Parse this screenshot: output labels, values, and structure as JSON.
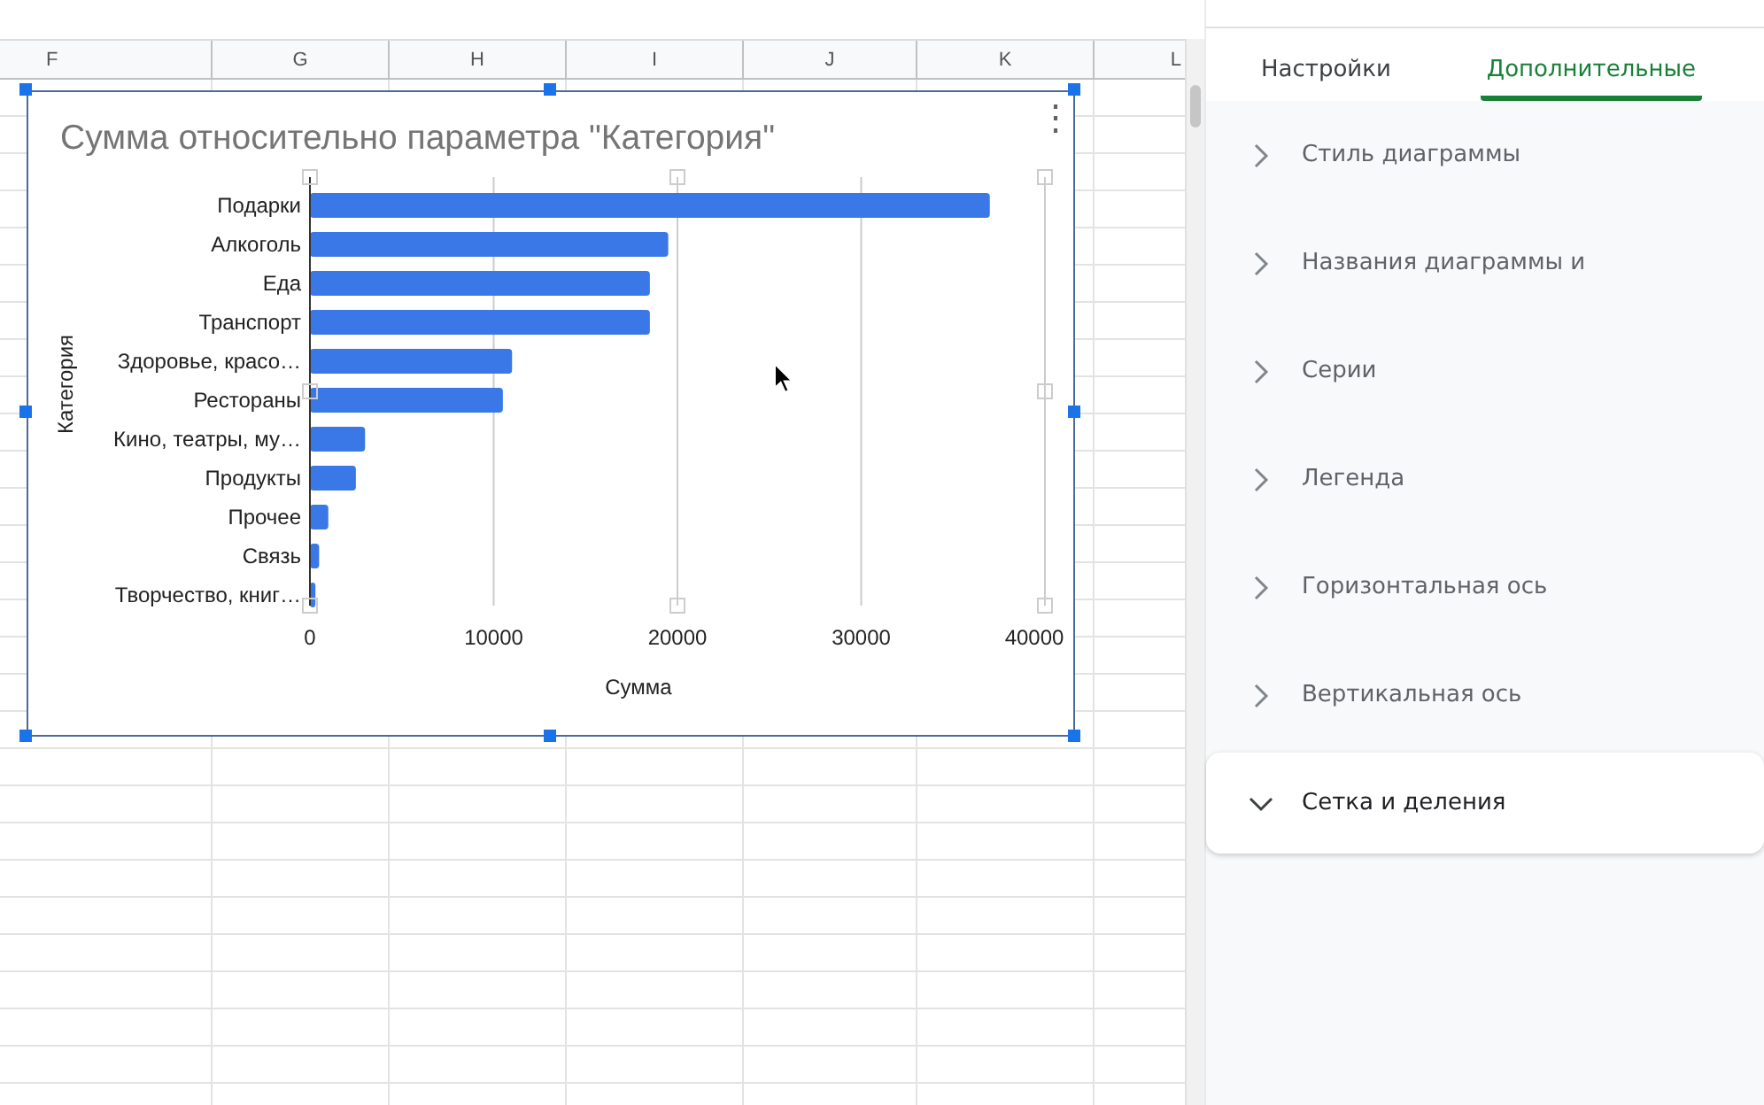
{
  "sheet": {
    "columns": [
      "F",
      "G",
      "H",
      "I",
      "J",
      "K",
      "L"
    ]
  },
  "chart": {
    "menu": "⋮",
    "chart_data": {
      "type": "bar",
      "orientation": "horizontal",
      "title": "Сумма относительно параметра \"Категория\"",
      "xlabel": "Сумма",
      "ylabel": "Категория",
      "categories": [
        "Подарки",
        "Алкоголь",
        "Еда",
        "Транспорт",
        "Здоровье, красо…",
        "Рестораны",
        "Кино, театры, му…",
        "Продукты",
        "Прочее",
        "Связь",
        "Творчество, книг…"
      ],
      "series": [
        {
          "color": "#3b78e7",
          "values": [
            37000,
            19500,
            18500,
            18500,
            11000,
            10500,
            3000,
            2500,
            1000,
            500,
            300
          ]
        }
      ],
      "xlim": [
        0,
        40000
      ],
      "xticks": [
        0,
        10000,
        20000,
        30000,
        40000
      ],
      "grid": true
    }
  },
  "panel": {
    "tabs": [
      {
        "label": "Настройки",
        "selected": false
      },
      {
        "label": "Дополнительные",
        "selected": true
      }
    ],
    "sections": [
      {
        "label": "Стиль диаграммы",
        "expanded": false
      },
      {
        "label": "Названия диаграммы и",
        "expanded": false
      },
      {
        "label": "Серии",
        "expanded": false
      },
      {
        "label": "Легенда",
        "expanded": false
      },
      {
        "label": "Горизонтальная ось",
        "expanded": false
      },
      {
        "label": "Вертикальная ось",
        "expanded": false
      },
      {
        "label": "Сетка и деления",
        "expanded": true
      }
    ]
  }
}
